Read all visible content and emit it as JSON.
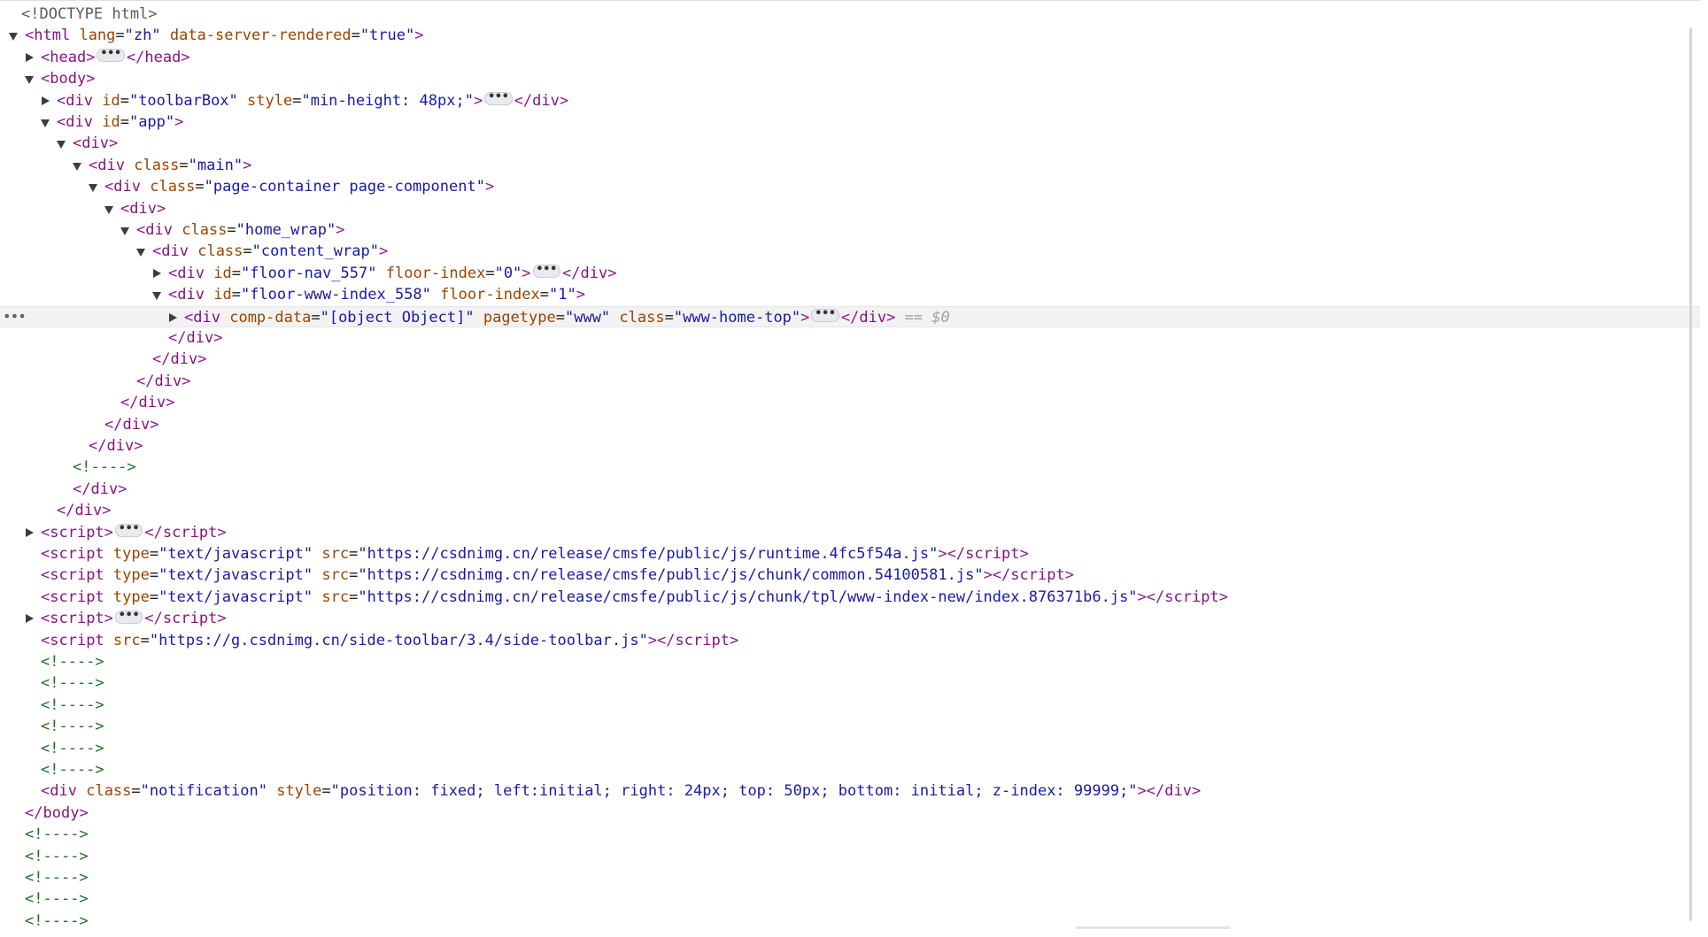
{
  "colors": {
    "tag": "#881280",
    "attribute_name": "#994500",
    "attribute_value": "#1a1aa6",
    "comment": "#236e25",
    "selected_row": "#f2f2f2"
  },
  "gutter": {
    "selected_row_menu": "•••"
  },
  "selected_suffix": "== $0",
  "ellipsis_label": "•••",
  "lines": [
    {
      "type": "doctype",
      "text": "<!DOCTYPE html>"
    },
    {
      "type": "open",
      "tag": "html",
      "attrs": [
        {
          "n": "lang",
          "v": "\"zh\""
        },
        {
          "n": "data-server-rendered",
          "v": "\"true\""
        }
      ]
    },
    {
      "type": "collapsed",
      "tag": "head",
      "attrs": []
    },
    {
      "type": "open",
      "tag": "body",
      "attrs": []
    },
    {
      "type": "collapsed",
      "tag": "div",
      "attrs": [
        {
          "n": "id",
          "v": "\"toolbarBox\""
        },
        {
          "n": "style",
          "v": "\"min-height: 48px;\""
        }
      ]
    },
    {
      "type": "open",
      "tag": "div",
      "attrs": [
        {
          "n": "id",
          "v": "\"app\""
        }
      ]
    },
    {
      "type": "open",
      "tag": "div",
      "attrs": []
    },
    {
      "type": "open",
      "tag": "div",
      "attrs": [
        {
          "n": "class",
          "v": "\"main\""
        }
      ]
    },
    {
      "type": "open",
      "tag": "div",
      "attrs": [
        {
          "n": "class",
          "v": "\"page-container page-component\""
        }
      ]
    },
    {
      "type": "open",
      "tag": "div",
      "attrs": []
    },
    {
      "type": "open",
      "tag": "div",
      "attrs": [
        {
          "n": "class",
          "v": "\"home_wrap\""
        }
      ]
    },
    {
      "type": "open",
      "tag": "div",
      "attrs": [
        {
          "n": "class",
          "v": "\"content_wrap\""
        }
      ]
    },
    {
      "type": "collapsed",
      "tag": "div",
      "attrs": [
        {
          "n": "id",
          "v": "\"floor-nav_557\""
        },
        {
          "n": "floor-index",
          "v": "\"0\""
        }
      ]
    },
    {
      "type": "open",
      "tag": "div",
      "attrs": [
        {
          "n": "id",
          "v": "\"floor-www-index_558\""
        },
        {
          "n": "floor-index",
          "v": "\"1\""
        }
      ]
    },
    {
      "type": "collapsed",
      "tag": "div",
      "selected": true,
      "attrs": [
        {
          "n": "comp-data",
          "v": "\"[object Object]\""
        },
        {
          "n": "pagetype",
          "v": "\"www\""
        },
        {
          "n": "class",
          "v": "\"www-home-top\""
        }
      ]
    },
    {
      "type": "close",
      "tag": "div"
    },
    {
      "type": "close",
      "tag": "div"
    },
    {
      "type": "close",
      "tag": "div"
    },
    {
      "type": "close",
      "tag": "div"
    },
    {
      "type": "close",
      "tag": "div"
    },
    {
      "type": "close",
      "tag": "div"
    },
    {
      "type": "comment",
      "text": "<!---->"
    },
    {
      "type": "close",
      "tag": "div"
    },
    {
      "type": "close",
      "tag": "div"
    },
    {
      "type": "collapsed",
      "tag": "script",
      "attrs": []
    },
    {
      "type": "inline",
      "tag": "script",
      "attrs": [
        {
          "n": "type",
          "v": "\"text/javascript\""
        },
        {
          "n": "src",
          "v": "\"https://csdnimg.cn/release/cmsfe/public/js/runtime.4fc5f54a.js\""
        }
      ]
    },
    {
      "type": "inline",
      "tag": "script",
      "attrs": [
        {
          "n": "type",
          "v": "\"text/javascript\""
        },
        {
          "n": "src",
          "v": "\"https://csdnimg.cn/release/cmsfe/public/js/chunk/common.54100581.js\""
        }
      ]
    },
    {
      "type": "inline",
      "tag": "script",
      "attrs": [
        {
          "n": "type",
          "v": "\"text/javascript\""
        },
        {
          "n": "src",
          "v": "\"https://csdnimg.cn/release/cmsfe/public/js/chunk/tpl/www-index-new/index.876371b6.js\""
        }
      ]
    },
    {
      "type": "collapsed",
      "tag": "script",
      "attrs": []
    },
    {
      "type": "inline",
      "tag": "script",
      "attrs": [
        {
          "n": "src",
          "v": "\"https://g.csdnimg.cn/side-toolbar/3.4/side-toolbar.js\""
        }
      ]
    },
    {
      "type": "comment",
      "text": "<!---->"
    },
    {
      "type": "comment",
      "text": "<!---->"
    },
    {
      "type": "comment",
      "text": "<!---->"
    },
    {
      "type": "comment",
      "text": "<!---->"
    },
    {
      "type": "comment",
      "text": "<!---->"
    },
    {
      "type": "comment",
      "text": "<!---->"
    },
    {
      "type": "inline",
      "tag": "div",
      "attrs": [
        {
          "n": "class",
          "v": "\"notification\""
        },
        {
          "n": "style",
          "v": "\"position: fixed; left:initial; right: 24px; top: 50px; bottom: initial; z-index: 99999;\""
        }
      ]
    },
    {
      "type": "close",
      "tag": "body"
    },
    {
      "type": "comment",
      "text": "<!---->"
    },
    {
      "type": "comment",
      "text": "<!---->"
    },
    {
      "type": "comment",
      "text": "<!---->"
    },
    {
      "type": "comment",
      "text": "<!---->"
    },
    {
      "type": "comment",
      "text": "<!---->"
    }
  ]
}
